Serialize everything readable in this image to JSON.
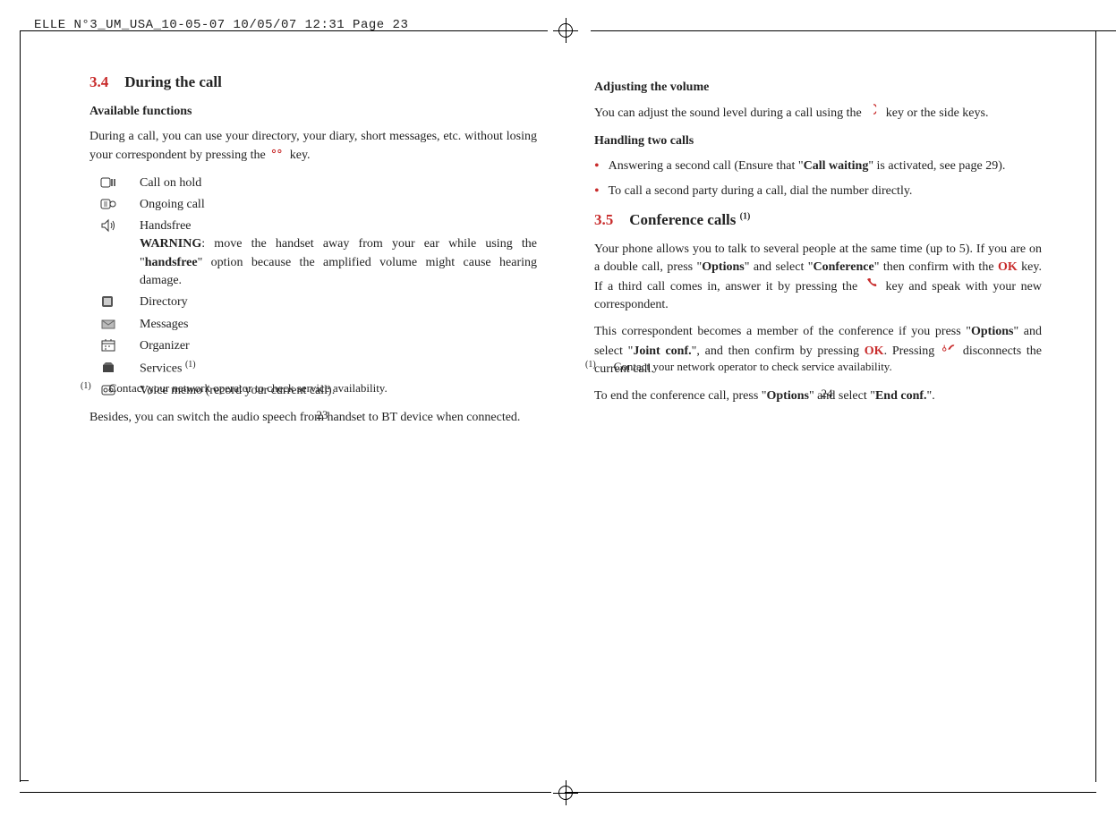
{
  "crop_header": "ELLE N°3_UM_USA_10-05-07  10/05/07  12:31  Page 23",
  "left": {
    "section_num": "3.4",
    "section_title": "During the call",
    "sub1": "Available functions",
    "intro_a": "During a call, you can use your directory, your diary, short messages, etc. without losing your correspondent by pressing the ",
    "intro_b": " key.",
    "funcs": {
      "hold": "Call on hold",
      "ongoing": "Ongoing call",
      "handsfree": "Handsfree",
      "warn_label": "WARNING",
      "warn_a": ": move the handset away from your ear while using the \"",
      "warn_bold": "handsfree",
      "warn_b": "\" option because the amplified volume might cause hearing damage.",
      "directory": "Directory",
      "messages": "Messages",
      "organizer": "Organizer",
      "services": "Services ",
      "voicememo": "Voice memo (record your current call)."
    },
    "after": "Besides, you can switch the audio speech from handset to BT device when connected.",
    "footnote_mark": "(1)",
    "footnote": "Contact your network operator to check service availability.",
    "pagenum": "23"
  },
  "right": {
    "sub_volume": "Adjusting the volume",
    "vol_a": "You can adjust the sound level during a call using the ",
    "vol_b": " key or the side keys.",
    "sub_two": "Handling two calls",
    "bullet1_a": "Answering a second call (Ensure that \"",
    "bullet1_bold": "Call waiting",
    "bullet1_b": "\" is activated, see page 29).",
    "bullet2": "To call a second party during a call, dial the number directly.",
    "section_num": "3.5",
    "section_title": "Conference calls ",
    "conf_p1_a": "Your phone allows you to talk to several people at the same time (up to 5). If you are on a double call, press \"",
    "conf_p1_b": "\" and select \"",
    "conf_p1_c": "\" then confirm with the ",
    "conf_p1_d": " key. If a third call comes in, answer it by pressing the ",
    "conf_p1_e": " key and speak with your new correspondent.",
    "options": "Options",
    "conference": "Conference",
    "conf_p2_a": "This correspondent becomes a member of the conference if you press \"",
    "conf_p2_b": "\" and select \"",
    "jointconf": "Joint conf.",
    "conf_p2_c": "\", and then confirm by pressing ",
    "conf_p2_d": ". Pressing ",
    "conf_p2_e": " disconnects the current call.",
    "conf_p3_a": "To end the conference call, press \"",
    "conf_p3_b": "\" and select \"",
    "endconf": "End conf.",
    "conf_p3_c": "\".",
    "footnote_mark": "(1)",
    "footnote": "Contact your network operator to check service availability.",
    "pagenum": "24"
  }
}
